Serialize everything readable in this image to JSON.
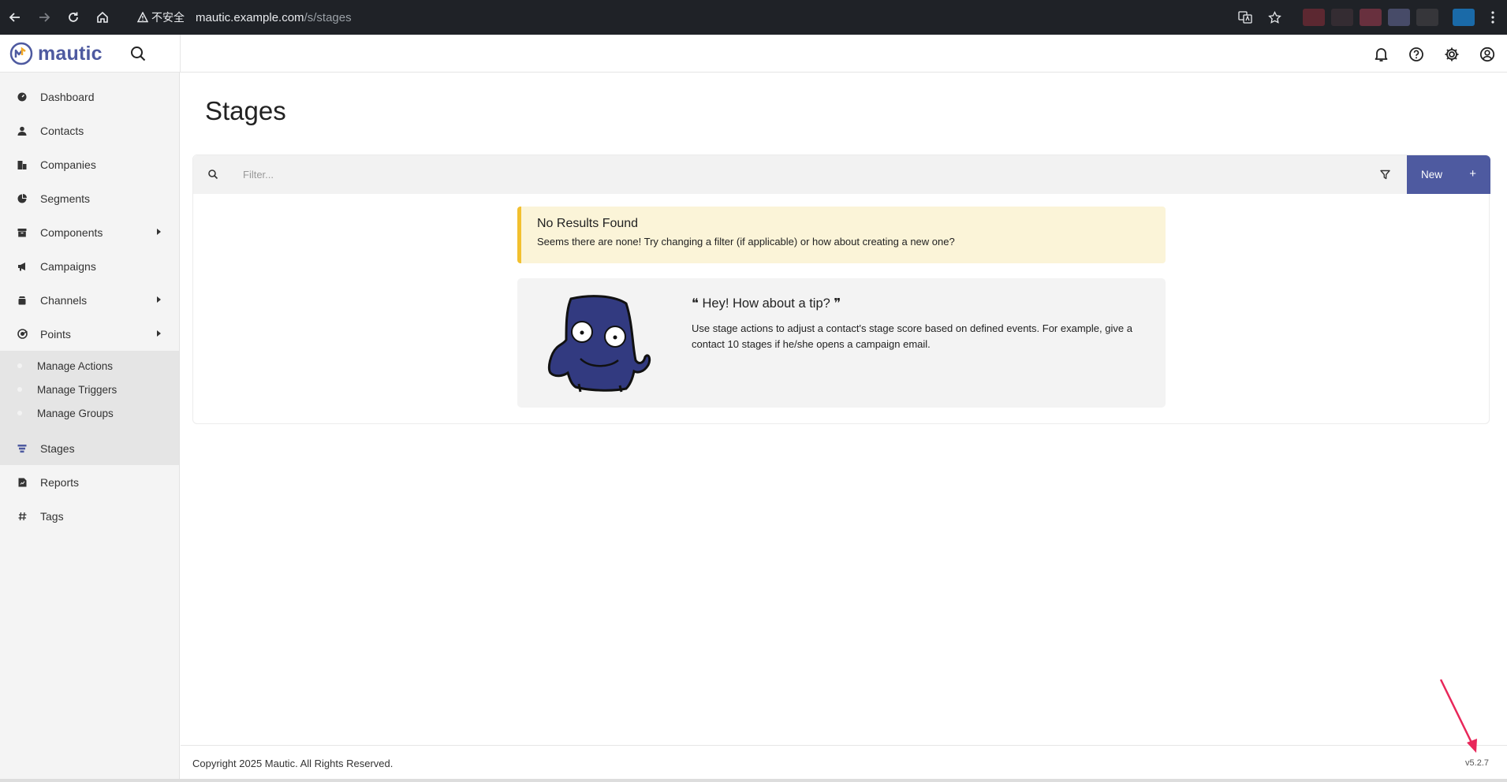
{
  "browser": {
    "insecure_label": "不安全",
    "url_host": "mautic.example.com",
    "url_path": "/s/stages"
  },
  "app": {
    "logo_text": "mautic",
    "brand_color": "#4e5aa0"
  },
  "sidebar": {
    "items": [
      {
        "label": "Dashboard",
        "icon": "dashboard-icon"
      },
      {
        "label": "Contacts",
        "icon": "user-icon"
      },
      {
        "label": "Companies",
        "icon": "building-icon"
      },
      {
        "label": "Segments",
        "icon": "pie-chart-icon"
      },
      {
        "label": "Components",
        "icon": "box-icon"
      },
      {
        "label": "Campaigns",
        "icon": "megaphone-icon"
      },
      {
        "label": "Channels",
        "icon": "channel-icon"
      },
      {
        "label": "Points",
        "icon": "points-icon"
      }
    ],
    "points_sub": [
      {
        "label": "Manage Actions"
      },
      {
        "label": "Manage Triggers"
      },
      {
        "label": "Manage Groups"
      }
    ],
    "stages_label": "Stages",
    "reports_label": "Reports",
    "tags_label": "Tags"
  },
  "main": {
    "title": "Stages",
    "filter_placeholder": "Filter...",
    "new_label": "New",
    "new_plus": "+",
    "alert_title": "No Results Found",
    "alert_text": "Seems there are none! Try changing a filter (if applicable) or how about creating a new one?",
    "tip_title": "Hey! How about a tip?",
    "tip_open_quote": "❝",
    "tip_close_quote": "❞",
    "tip_text": "Use stage actions to adjust a contact's stage score based on defined events. For example, give a contact 10 stages if he/she opens a campaign email."
  },
  "footer": {
    "copyright": "Copyright 2025 Mautic. All Rights Reserved.",
    "version": "v5.2.7"
  }
}
